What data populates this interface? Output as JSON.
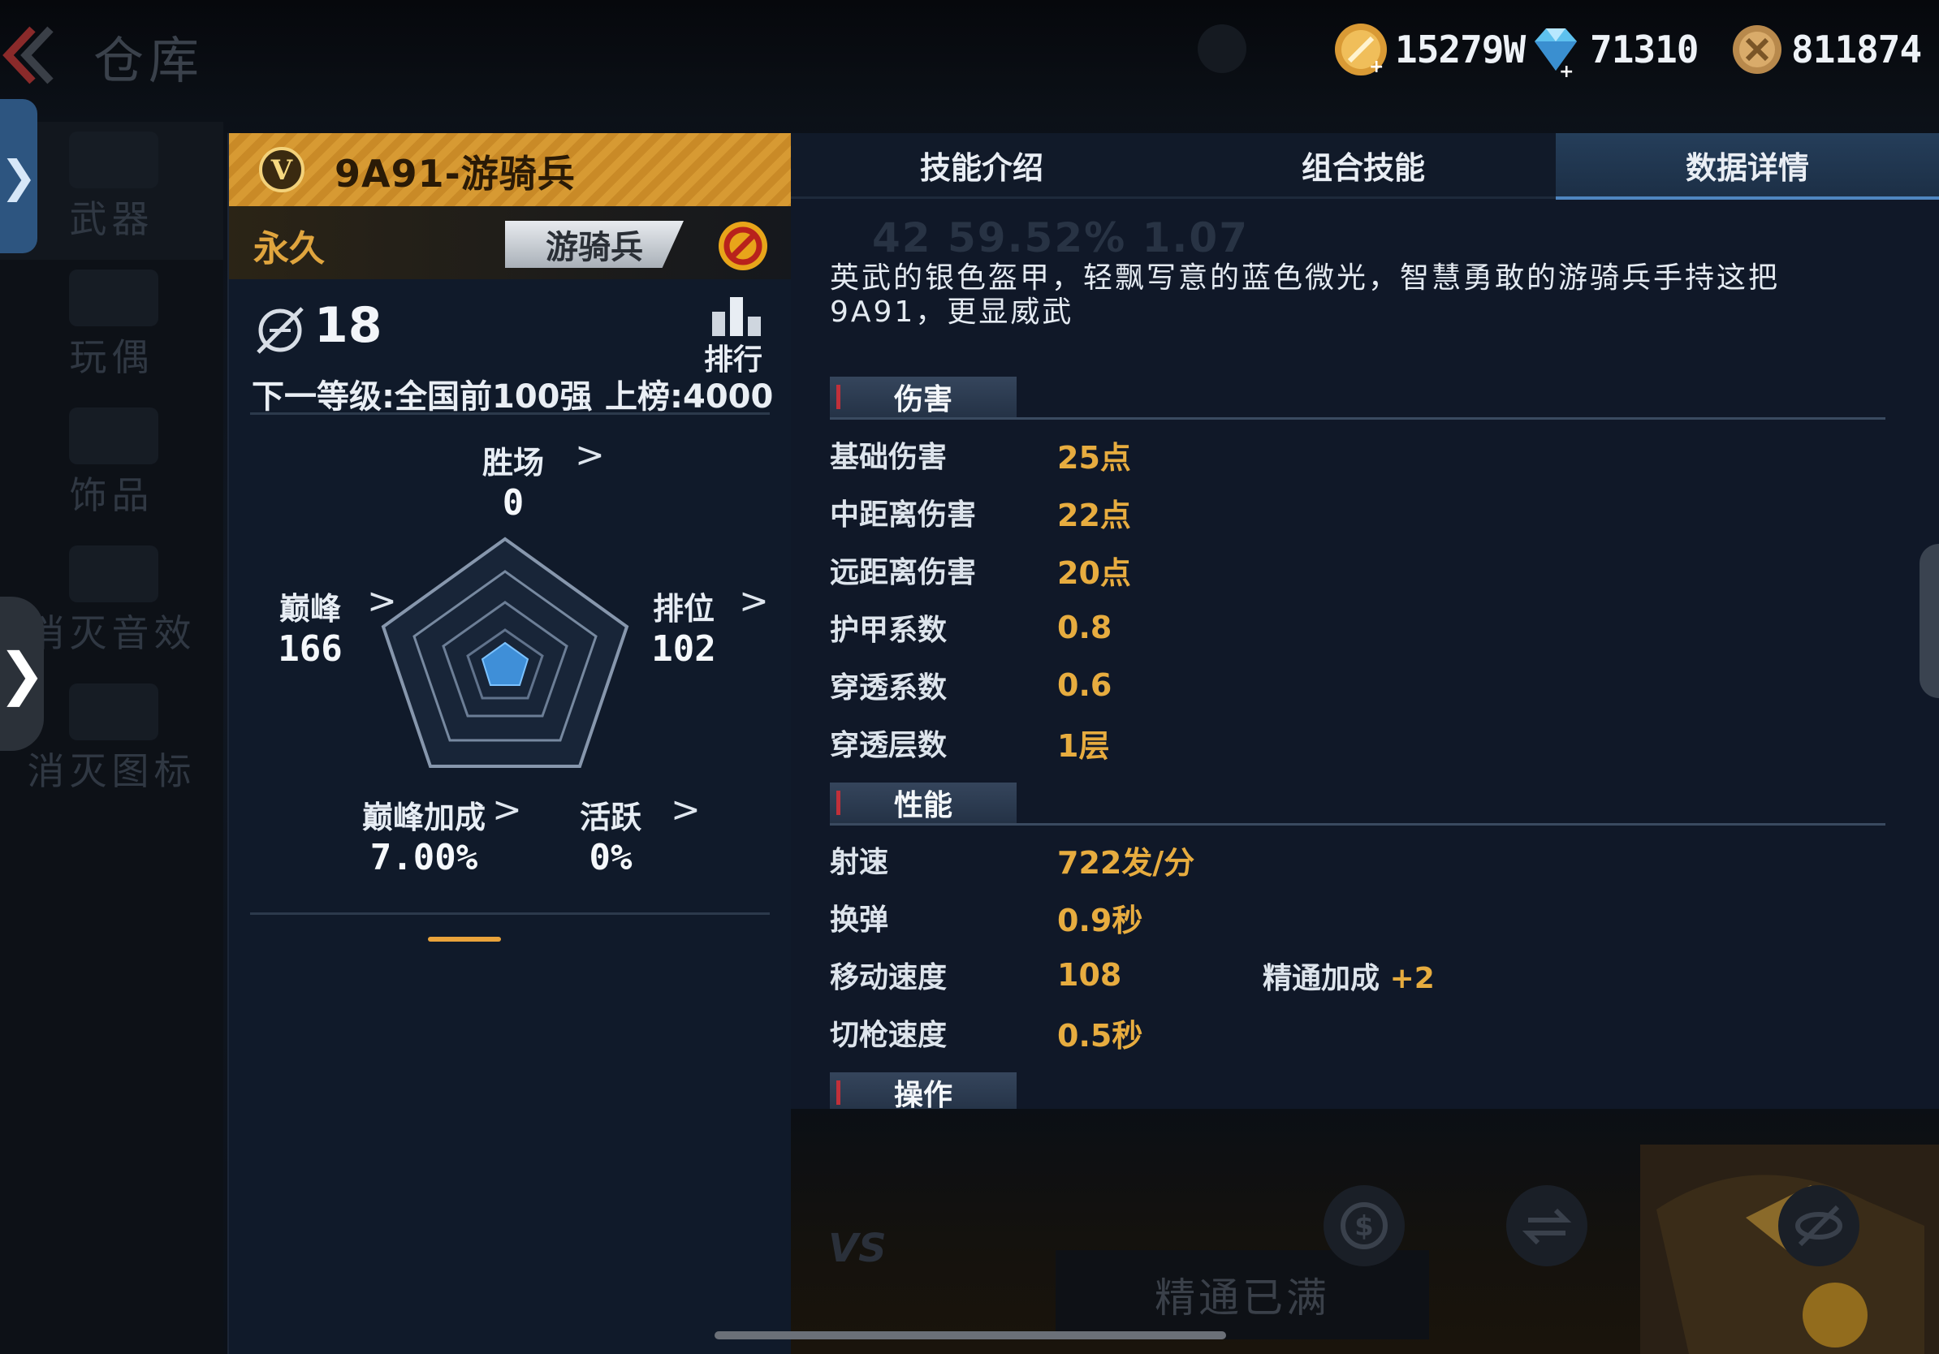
{
  "topbar": {
    "title": "仓库",
    "currencies": [
      {
        "icon": "gold-coin-icon",
        "value": "15279W"
      },
      {
        "icon": "diamond-icon",
        "value": "71310"
      },
      {
        "icon": "medal-coin-icon",
        "value": "811874"
      }
    ]
  },
  "sidenav": {
    "items": [
      {
        "label": "武器",
        "active": true
      },
      {
        "label": "玩偶"
      },
      {
        "label": "饰品"
      },
      {
        "label": "消灭音效"
      },
      {
        "label": "消灭图标"
      }
    ],
    "expand_tab": "❯"
  },
  "weapon": {
    "name": "9A91-游骑兵",
    "duration": "永久",
    "class_badge": "游骑兵",
    "rank": "18",
    "leaderboard_label": "排行",
    "next_level": "下一等级:全国前100强",
    "on_board": "上榜:4000",
    "stats": {
      "wins": {
        "name": "胜场",
        "value": "0"
      },
      "peak": {
        "name": "巅峰",
        "value": "166"
      },
      "ranked": {
        "name": "排位",
        "value": "102"
      },
      "peak_bonus": {
        "name": "巅峰加成",
        "value": "7.00%"
      },
      "active": {
        "name": "活跃",
        "value": "0%"
      }
    }
  },
  "info": {
    "tabs": [
      {
        "label": "技能介绍",
        "active": false
      },
      {
        "label": "组合技能",
        "active": false
      },
      {
        "label": "数据详情",
        "active": true
      }
    ],
    "ghost_stats": "42   59.52%   1.07",
    "description": "英武的银色盔甲，轻飘写意的蓝色微光，智慧勇敢的游骑兵手持这把9A91，更显威武",
    "sections": {
      "damage": {
        "title": "伤害",
        "rows": [
          {
            "k": "基础伤害",
            "v": "25点"
          },
          {
            "k": "中距离伤害",
            "v": "22点"
          },
          {
            "k": "远距离伤害",
            "v": "20点"
          },
          {
            "k": "护甲系数",
            "v": "0.8"
          },
          {
            "k": "穿透系数",
            "v": "0.6"
          },
          {
            "k": "穿透层数",
            "v": "1层"
          }
        ]
      },
      "performance": {
        "title": "性能",
        "rows": [
          {
            "k": "射速",
            "v": "722发/分"
          },
          {
            "k": "换弹",
            "v": "0.9秒"
          },
          {
            "k": "移动速度",
            "v": "108"
          },
          {
            "k": "切枪速度",
            "v": "0.5秒"
          }
        ],
        "mastery_bonus_label": "精通加成",
        "mastery_bonus_value": "+2"
      },
      "operation": {
        "title": "操作"
      }
    },
    "mastered_label": "精通已满",
    "vs_label": "VS"
  },
  "colors": {
    "accent_gold": "#e7ac3f",
    "tab_active": "#253e5a",
    "header_gold": "#d79a33"
  }
}
